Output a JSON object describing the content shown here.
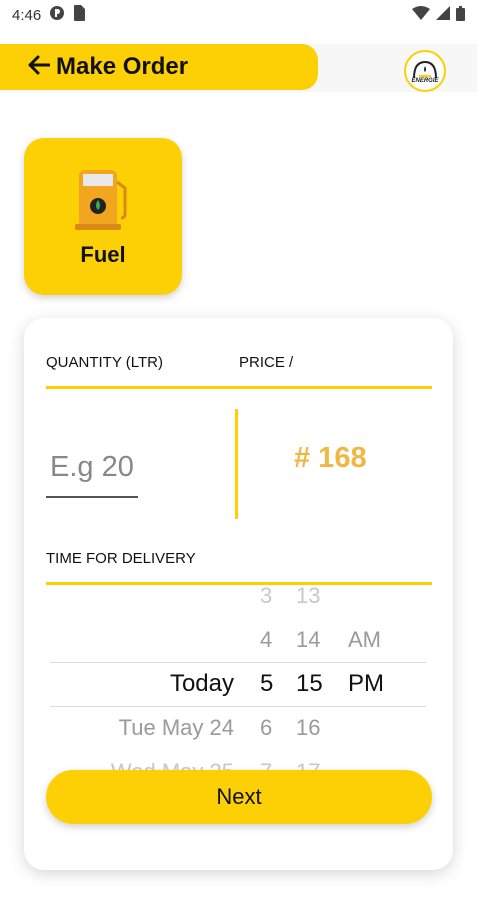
{
  "status_bar": {
    "time": "4:46"
  },
  "header": {
    "title": "Make Order",
    "logo_text": "ENERGIE"
  },
  "service": {
    "label": "Fuel"
  },
  "order": {
    "quantity_label": "QUANTITY (LTR)",
    "price_label": "PRICE /",
    "quantity_placeholder": "E.g 20",
    "price_value": "# 168",
    "delivery_label": "TIME FOR DELIVERY",
    "next_label": "Next"
  },
  "picker": {
    "rows": [
      {
        "day": "",
        "hour": "3",
        "minute": "13",
        "ampm": ""
      },
      {
        "day": "",
        "hour": "4",
        "minute": "14",
        "ampm": "AM"
      },
      {
        "day": "Today",
        "hour": "5",
        "minute": "15",
        "ampm": "PM"
      },
      {
        "day": "Tue May 24",
        "hour": "6",
        "minute": "16",
        "ampm": ""
      },
      {
        "day": "Wed May 25",
        "hour": "7",
        "minute": "17",
        "ampm": ""
      }
    ],
    "selected_index": 2
  },
  "colors": {
    "accent": "#fdd005",
    "price": "#f2b643"
  }
}
